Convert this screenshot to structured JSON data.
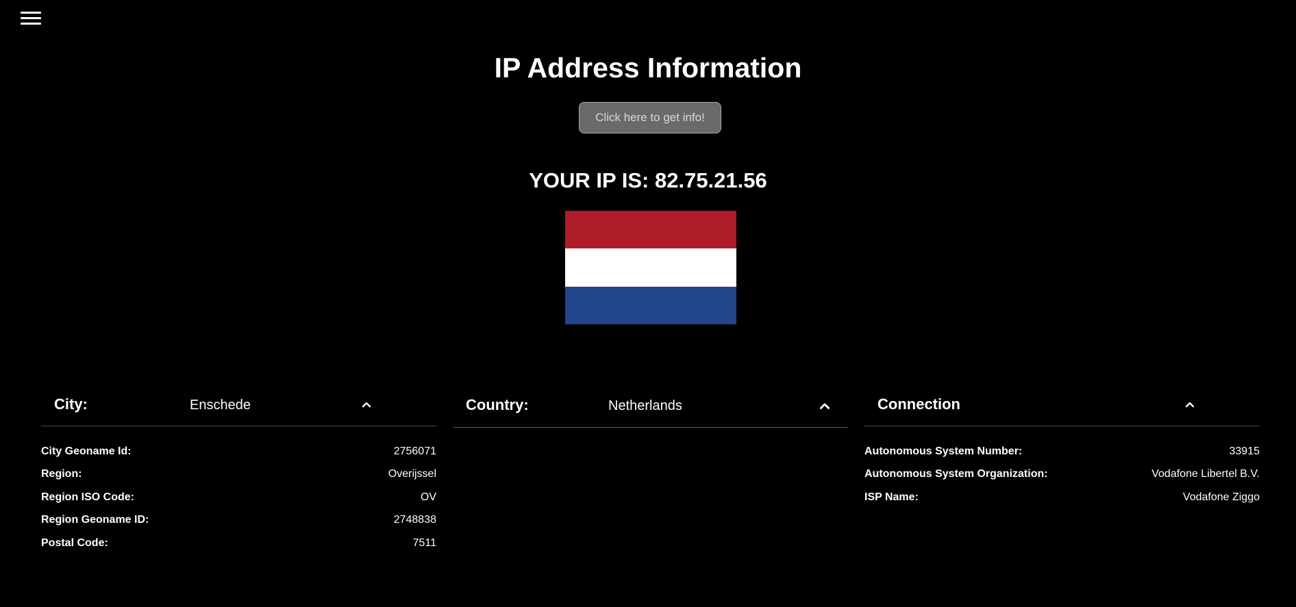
{
  "header": {
    "menu_icon": "hamburger-menu-icon",
    "title": "IP Address Information"
  },
  "action": {
    "button_label": "Click here to get info!"
  },
  "ip": {
    "text": "YOUR IP IS: 82.75.21.56"
  },
  "flag": {
    "country": "Netherlands",
    "colors": [
      "#ae1c28",
      "#ffffff",
      "#21468b"
    ]
  },
  "city_panel": {
    "label": "City:",
    "value": "Enschede",
    "toggle_icon": "chevron-up-icon",
    "rows": [
      {
        "key": "City Geoname Id:",
        "value": "2756071"
      },
      {
        "key": "Region:",
        "value": "Overijssel"
      },
      {
        "key": "Region ISO Code:",
        "value": "OV"
      },
      {
        "key": "Region Geoname ID:",
        "value": "2748838"
      },
      {
        "key": "Postal Code:",
        "value": "7511"
      }
    ]
  },
  "country_panel": {
    "label": "Country:",
    "value": "Netherlands",
    "toggle_icon": "chevron-up-icon",
    "rows": []
  },
  "connection_panel": {
    "label": "Connection",
    "toggle_icon": "chevron-up-icon",
    "rows": [
      {
        "key": "Autonomous System Number:",
        "value": "33915"
      },
      {
        "key": "Autonomous System Organization:",
        "value": "Vodafone Libertel B.V."
      },
      {
        "key": "ISP Name:",
        "value": "Vodafone Ziggo"
      }
    ]
  },
  "theme": {
    "background": "#000000",
    "text": "#ffffff",
    "button_bg": "#6a6a6a",
    "divider": "#4a4a4a"
  }
}
